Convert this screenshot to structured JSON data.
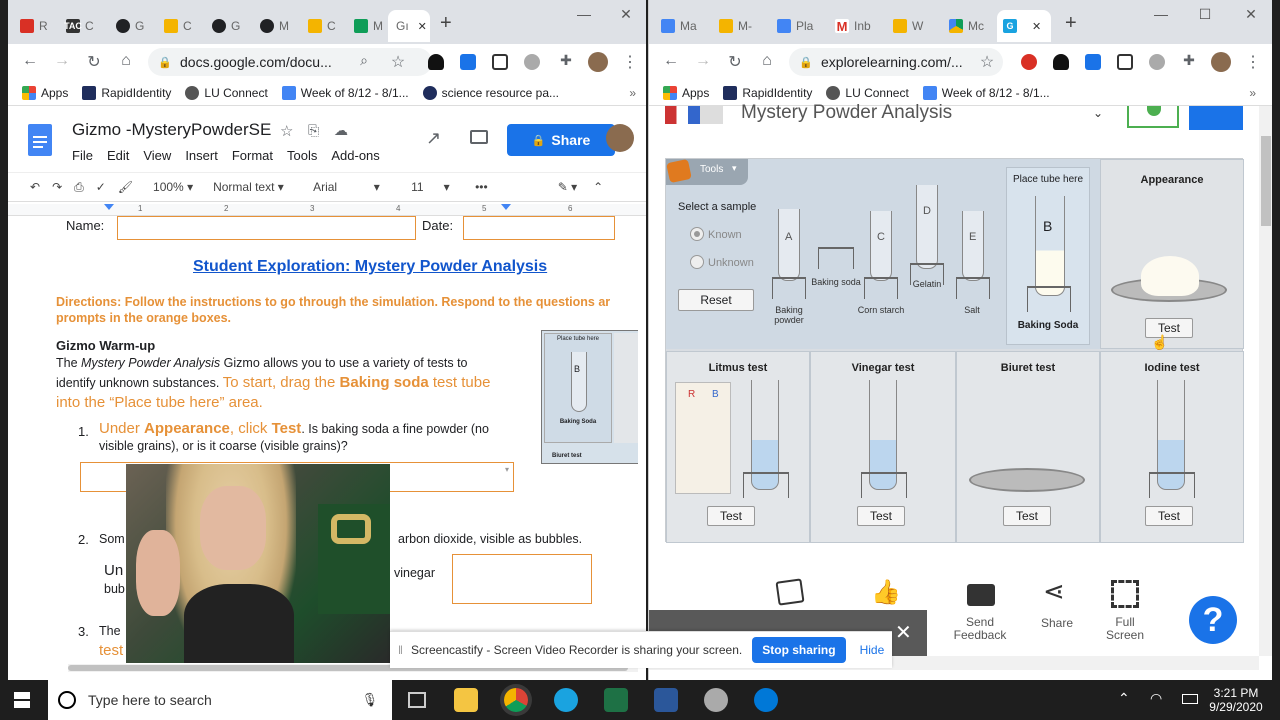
{
  "left_browser": {
    "tabs": [
      {
        "letter": "R",
        "color": "#d93025"
      },
      {
        "letter": "C",
        "color": "#444",
        "badge": "TAC"
      },
      {
        "letter": "G",
        "color": "#202124"
      },
      {
        "letter": "C",
        "color": "#f4b400"
      },
      {
        "letter": "G",
        "color": "#202124"
      },
      {
        "letter": "M",
        "color": "#202124"
      },
      {
        "letter": "C",
        "color": "#f4b400"
      },
      {
        "letter": "M",
        "color": "#0f9d58"
      }
    ],
    "active_tab_label": "Gı",
    "url": "docs.google.com/docu...",
    "bookmarks": [
      "Apps",
      "RapidIdentity",
      "LU Connect",
      "Week of 8/12 - 8/1...",
      "science resource pa..."
    ],
    "doc_title": "Gizmo -MysteryPowderSE",
    "menu": [
      "File",
      "Edit",
      "View",
      "Insert",
      "Format",
      "Tools",
      "Add-ons"
    ],
    "share_label": "Share",
    "toolbar": {
      "zoom": "100%",
      "style": "Normal text",
      "font": "Arial",
      "size": "11"
    },
    "ruler_numbers": [
      "1",
      "2",
      "3",
      "4",
      "5",
      "6"
    ],
    "doc": {
      "name_label": "Name:",
      "date_label": "Date:",
      "heading": "Student Exploration: Mystery Powder Analysis",
      "directions": "Directions: Follow the instructions to go through the simulation. Respond to the questions ar prompts in the orange boxes.",
      "warmup_title": "Gizmo Warm-up",
      "warmup_p1": "The ",
      "warmup_em": "Mystery Powder Analysis",
      "warmup_p2": " Gizmo allows you to use a variety of tests to identify unknown substances. ",
      "warmup_o1": "To start, drag the ",
      "warmup_ob": "Baking soda",
      "warmup_o2": " test tube into the “Place tube here” area.",
      "q1_num": "1.",
      "q1_o1": "Under ",
      "q1_ob1": "Appearance",
      "q1_o2": ", click ",
      "q1_ob2": "Test",
      "q1_rest": ". Is baking soda a fine powder (no visible grains), or is it coarse (visible grains)?",
      "q2_num": "2.",
      "q2_start": "Som",
      "q2_end": "arbon dioxide, visible as bubbles.",
      "q2_o": "Un",
      "q2_o2": "bub",
      "q2_vinegar": "vinegar",
      "q3_num": "3.",
      "q3_start": "The",
      "q3_o": "test",
      "thumb_place": "Place tube here",
      "thumb_b": "B",
      "thumb_bs": "Baking Soda",
      "thumb_biuret": "Biuret test"
    }
  },
  "right_browser": {
    "tabs": [
      {
        "label": "Ma",
        "color": "#4285f4"
      },
      {
        "label": "M-",
        "color": "#f4b400"
      },
      {
        "label": "Pla",
        "color": "#4285f4"
      },
      {
        "label": "Inb",
        "color": "#d93025"
      },
      {
        "label": "W",
        "color": "#f4b400"
      },
      {
        "label": "Mc",
        "color": "#0f9d58"
      }
    ],
    "url": "explorelearning.com/...",
    "bookmarks": [
      "Apps",
      "RapidIdentity",
      "LU Connect",
      "Week of 8/12 - 8/1..."
    ],
    "gizmo_title": "Mystery Powder Analysis",
    "tools_label": "Tools",
    "select_sample": "Select a sample",
    "known": "Known",
    "unknown": "Unknown",
    "reset": "Reset",
    "samples": [
      {
        "letter": "A",
        "label": "Baking powder"
      },
      {
        "letter": "",
        "label": "Baking soda"
      },
      {
        "letter": "C",
        "label": "Corn starch"
      },
      {
        "letter": "D",
        "label": "Gelatin"
      },
      {
        "letter": "E",
        "label": "Salt"
      }
    ],
    "place_tube": "Place tube here",
    "placed_letter": "B",
    "placed_label": "Baking Soda",
    "appearance": "Appearance",
    "tests": [
      "Litmus test",
      "Vinegar test",
      "Biuret test",
      "Iodine test"
    ],
    "test_btn": "Test",
    "litmus_r": "R",
    "litmus_b": "B",
    "bottom_bar": [
      {
        "label": "Send Feedback"
      },
      {
        "label": "Share"
      },
      {
        "label": "Full Screen"
      }
    ],
    "help": "?"
  },
  "screencastify": {
    "message": "Screencastify - Screen Video Recorder is sharing your screen.",
    "stop": "Stop sharing",
    "hide": "Hide"
  },
  "taskbar": {
    "search_placeholder": "Type here to search",
    "time": "3:21 PM",
    "date": "9/29/2020"
  }
}
